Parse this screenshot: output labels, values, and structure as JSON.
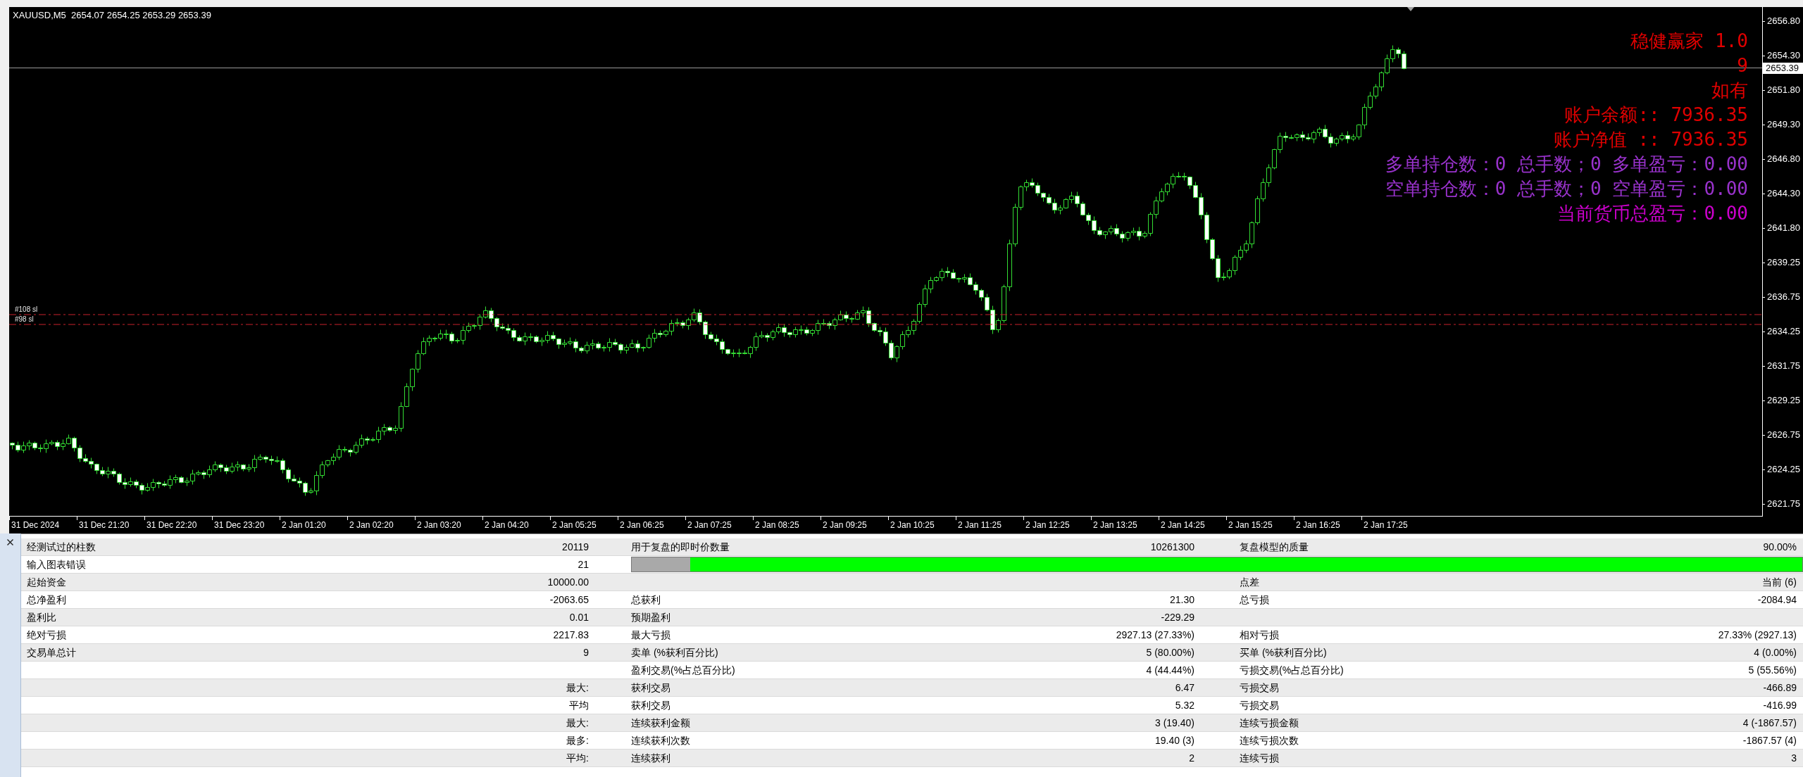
{
  "chart_window": {
    "header": "XAUUSD,M5  2654.07 2654.25 2653.29 2653.39",
    "overlay": [
      {
        "text": "稳健赢家 1.0",
        "color": "#e00000"
      },
      {
        "text": "9",
        "color": "#e00000"
      },
      {
        "text": "如有",
        "color": "#e00000"
      },
      {
        "text": "账户余额:: 7936.35",
        "color": "#e00000"
      },
      {
        "text": "账户净值 :: 7936.35",
        "color": "#e00000"
      },
      {
        "text": "多单持仓数：0 总手数；0 多单盈亏：0.00",
        "color": "#9932cc"
      },
      {
        "text": "空单持仓数：0 总手数；0 空单盈亏：0.00",
        "color": "#9932cc"
      },
      {
        "text": "当前货币总盈亏：0.00",
        "color": "#cc00cc"
      }
    ],
    "order_lines": [
      {
        "label": "#108 sl"
      },
      {
        "label": "#98 sl"
      }
    ],
    "price_axis": [
      "2656.80",
      "2654.30",
      "2651.80",
      "2649.30",
      "2646.80",
      "2644.30",
      "2641.80",
      "2639.25",
      "2636.75",
      "2634.25",
      "2631.75",
      "2629.25",
      "2626.75",
      "2624.25",
      "2621.75"
    ],
    "current_price": "2653.39",
    "time_axis": [
      "31 Dec 2024",
      "31 Dec 21:20",
      "31 Dec 22:20",
      "31 Dec 23:20",
      "2 Jan 01:20",
      "2 Jan 02:20",
      "2 Jan 03:20",
      "2 Jan 04:20",
      "2 Jan 05:25",
      "2 Jan 06:25",
      "2 Jan 07:25",
      "2 Jan 08:25",
      "2 Jan 09:25",
      "2 Jan 10:25",
      "2 Jan 11:25",
      "2 Jan 12:25",
      "2 Jan 13:25",
      "2 Jan 14:25",
      "2 Jan 15:25",
      "2 Jan 16:25",
      "2 Jan 17:25"
    ]
  },
  "report": {
    "rows": [
      {
        "kind": "stats",
        "label_1": "经测试过的柱数",
        "value_1": "20119",
        "label_2": "用于复盘的即时价数量",
        "value_2": "10261300",
        "label_3": "复盘模型的质量",
        "value_3": "90.00%"
      },
      {
        "kind": "quality_bar",
        "label_1": "输入图表错误",
        "value_1": "21",
        "level": 0.95
      },
      {
        "kind": "stats",
        "label_1": "起始资金",
        "value_1": "10000.00",
        "label_3": "点差",
        "value_3": "当前 (6)"
      },
      {
        "kind": "stats",
        "label_1": "总净盈利",
        "value_1": "-2063.65",
        "label_2": "总获利",
        "value_2": "21.30",
        "label_3": "总亏损",
        "value_3": "-2084.94"
      },
      {
        "kind": "stats",
        "label_1": "盈利比",
        "value_1": "0.01",
        "label_2": "预期盈利",
        "value_2": "-229.29"
      },
      {
        "kind": "stats",
        "label_1": "绝对亏损",
        "value_1": "2217.83",
        "label_2": "最大亏损",
        "value_2": "2927.13 (27.33%)",
        "label_3": "相对亏损",
        "value_3": "27.33% (2927.13)"
      },
      {
        "kind": "stats",
        "label_1": "交易单总计",
        "value_1": "9",
        "label_2": "卖单 (%获利百分比)",
        "value_2": "5 (80.00%)",
        "label_3": "买单 (%获利百分比)",
        "value_3": "4 (0.00%)"
      },
      {
        "kind": "stats",
        "label_2": "盈利交易(%占总百分比)",
        "value_2": "4 (44.44%)",
        "label_3": "亏损交易(%占总百分比)",
        "value_3": "5 (55.56%)"
      },
      {
        "kind": "stats",
        "value_1": "最大:",
        "label_2": "获利交易",
        "value_2": "6.47",
        "label_3": "亏损交易",
        "value_3": "-466.89"
      },
      {
        "kind": "stats",
        "value_1": "平均",
        "label_2": "获利交易",
        "value_2": "5.32",
        "label_3": "亏损交易",
        "value_3": "-416.99"
      },
      {
        "kind": "stats",
        "value_1": "最大:",
        "label_2": "连续获利金额",
        "value_2": "3 (19.40)",
        "label_3": "连续亏损金额",
        "value_3": "4 (-1867.57)"
      },
      {
        "kind": "stats",
        "value_1": "最多:",
        "label_2": "连续获利次数",
        "value_2": "19.40 (3)",
        "label_3": "连续亏损次数",
        "value_3": "-1867.57 (4)"
      },
      {
        "kind": "stats",
        "value_1": "平均:",
        "label_2": "连续获利",
        "value_2": "2",
        "label_3": "连续亏损",
        "value_3": "3"
      }
    ]
  }
}
